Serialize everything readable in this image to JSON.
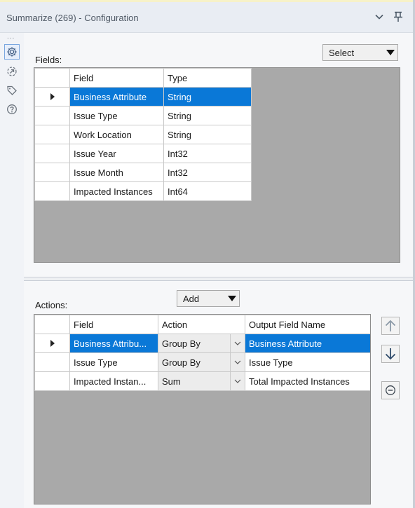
{
  "window": {
    "title": "Summarize (269) - Configuration",
    "collapse_icon": "chevron-down-icon",
    "pin_icon": "pin-icon"
  },
  "rail": {
    "dots": "...",
    "icons": [
      "gear-icon",
      "connection-icon",
      "tag-icon",
      "help-icon"
    ]
  },
  "fields": {
    "label": "Fields:",
    "select_button": "Select",
    "columns": [
      "Field",
      "Type"
    ],
    "rows": [
      {
        "field": "Business Attribute",
        "type": "String",
        "selected": true
      },
      {
        "field": "Issue Type",
        "type": "String"
      },
      {
        "field": "Work Location",
        "type": "String"
      },
      {
        "field": "Issue Year",
        "type": "Int32"
      },
      {
        "field": "Issue Month",
        "type": "Int32"
      },
      {
        "field": "Impacted Instances",
        "type": "Int64"
      }
    ]
  },
  "actions": {
    "label": "Actions:",
    "add_button": "Add",
    "columns": [
      "Field",
      "Action",
      "Output Field Name"
    ],
    "rows": [
      {
        "field": "Business Attribu...",
        "action": "Group By",
        "output": "Business Attribute",
        "selected": true
      },
      {
        "field": "Issue Type",
        "action": "Group By",
        "output": "Issue Type"
      },
      {
        "field": "Impacted Instan...",
        "action": "Sum",
        "output": "Total Impacted Instances"
      }
    ],
    "side_buttons": [
      "arrow-up-icon",
      "arrow-down-icon",
      "remove-icon"
    ]
  },
  "colors": {
    "selection": "#0a78d7",
    "grid_background": "#a9a9a9",
    "titlebar": "#e9edf3"
  }
}
